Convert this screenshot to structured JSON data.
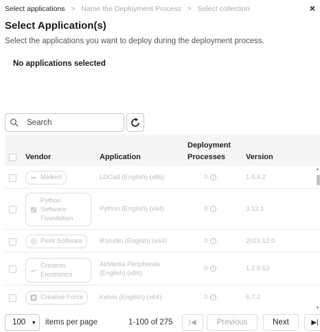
{
  "breadcrumb": {
    "items": [
      "Select applications",
      "Name the Deployment Process",
      "Select collection"
    ],
    "separator": ">"
  },
  "close_label": "×",
  "header": {
    "title": "Select Application(s)",
    "subtitle": "Select the applications you want to deploy during the deployment process."
  },
  "selection": {
    "empty_message": "No applications selected"
  },
  "search": {
    "placeholder": "Search"
  },
  "table": {
    "columns": {
      "vendor": "Vendor",
      "application": "Application",
      "deployment_line1": "Deployment",
      "deployment_line2": "Processes",
      "version": "Version"
    },
    "rows": [
      {
        "vendor": "Melkert",
        "application": "LDCad (English) (x86)",
        "deployments": "0",
        "version": "1.6.4.2"
      },
      {
        "vendor_l1": "Python",
        "vendor_l2": "Software",
        "vendor_l3": "Foundation",
        "application": "Python (English) (x64)",
        "deployments": "0",
        "version": "3.12.1"
      },
      {
        "vendor": "Posit Software",
        "application": "RStudio (English) (x64)",
        "deployments": "0",
        "version": "2023.12.0"
      },
      {
        "vendor_l1": "Crestron",
        "vendor_l2": "Electronics",
        "application_l1": "AirMedia Peripherals",
        "application_l2": "(English) (x86)",
        "deployments": "0",
        "version": "1.2.0.53"
      },
      {
        "vendor": "Creative Force",
        "application": "Kelvin (English) (x64)",
        "deployments": "0",
        "version": "5.7.2"
      }
    ],
    "info_glyph": "i"
  },
  "pagination": {
    "per_page": "100",
    "per_page_label": "items per page",
    "range_label": "1-100 of 275",
    "first_glyph": "|◀",
    "previous_label": "Previous",
    "next_label": "Next",
    "last_glyph": "▶|"
  }
}
